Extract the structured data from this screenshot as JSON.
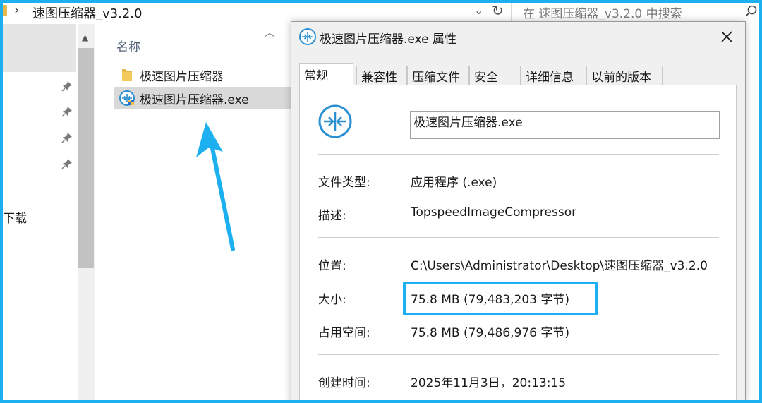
{
  "explorer": {
    "path": "速图压缩器_v3.2.0",
    "search_placeholder": "在 速图压缩器_v3.2.0 中搜索",
    "nav_download_label": "下载",
    "column_name": "名称",
    "files": [
      {
        "name": "极速图片压缩器",
        "icon": "folder-icon"
      },
      {
        "name": "极速图片压缩器.exe",
        "icon": "app-icon"
      }
    ]
  },
  "dialog": {
    "title": "极速图片压缩器.exe 属性",
    "tabs": [
      "常规",
      "兼容性",
      "压缩文件",
      "安全",
      "详细信息",
      "以前的版本"
    ],
    "active_tab": 0,
    "file_name_value": "极速图片压缩器.exe",
    "rows": [
      {
        "label": "文件类型:",
        "value": "应用程序 (.exe)"
      },
      {
        "label": "描述:",
        "value": "TopspeedImageCompressor"
      },
      {
        "label": "位置:",
        "value": "C:\\Users\\Administrator\\Desktop\\速图压缩器_v3.2.0"
      },
      {
        "label": "大小:",
        "value": "75.8 MB (79,483,203 字节)"
      },
      {
        "label": "占用空间:",
        "value": "75.8 MB (79,486,976 字节)"
      },
      {
        "label": "创建时间:",
        "value": "2025年11月3日，20:13:15"
      }
    ]
  },
  "colors": {
    "accent": "#1cb0f0",
    "app_icon": "#2a8fd0",
    "selection": "#d9d9d9"
  }
}
